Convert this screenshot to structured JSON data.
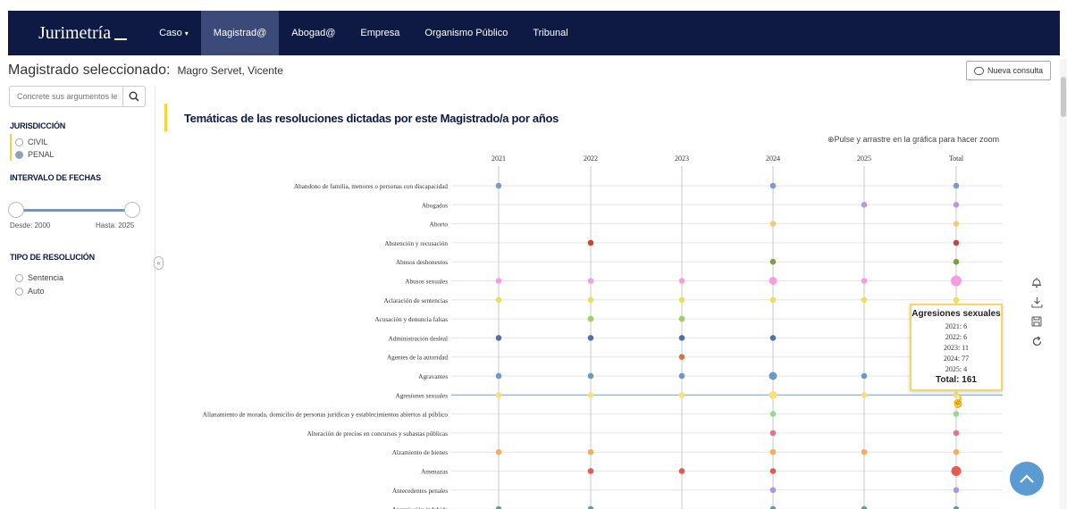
{
  "app": {
    "brand": "Jurimetría"
  },
  "nav": [
    {
      "label": "Caso",
      "dropdown": true,
      "active": false
    },
    {
      "label": "Magistrad@",
      "dropdown": false,
      "active": true
    },
    {
      "label": "Abogad@",
      "dropdown": false,
      "active": false
    },
    {
      "label": "Empresa",
      "dropdown": false,
      "active": false
    },
    {
      "label": "Organismo Público",
      "dropdown": false,
      "active": false
    },
    {
      "label": "Tribunal",
      "dropdown": false,
      "active": false
    }
  ],
  "header": {
    "selected_label": "Magistrado seleccionado:",
    "selected_value": "Magro Servet, Vicente",
    "new_query": "Nueva consulta"
  },
  "sidebar": {
    "search_placeholder": "Concrete sus argumentos le",
    "jurisdiccion_title": "JURISDICCIÓN",
    "jurisdicciones": [
      {
        "label": "CIVIL",
        "selected": false
      },
      {
        "label": "PENAL",
        "selected": true
      }
    ],
    "intervalo_title": "INTERVALO DE FECHAS",
    "desde": "Desde: 2000",
    "hasta": "Hasta: 2025",
    "tipo_title": "TIPO DE RESOLUCIÓN",
    "tipos": [
      {
        "label": "Sentencia",
        "selected": false
      },
      {
        "label": "Auto",
        "selected": false
      }
    ]
  },
  "chart": {
    "title": "Temáticas de las resoluciones dictadas por este Magistrado/a por años",
    "zoom_hint": "Pulse y arrastre en la gráfica para hacer zoom"
  },
  "chart_data": {
    "type": "scatter",
    "columns": [
      "2021",
      "2022",
      "2023",
      "2024",
      "2025",
      "Total"
    ],
    "rows": [
      {
        "label": "Abandono de familia, menores o personas con discapacidad",
        "color": "#7b9cc9",
        "present": [
          1,
          0,
          0,
          1,
          0,
          1
        ]
      },
      {
        "label": "Abogados",
        "color": "#b79ad8",
        "present": [
          0,
          0,
          0,
          0,
          1,
          1
        ]
      },
      {
        "label": "Aborto",
        "color": "#f7c97a",
        "present": [
          0,
          0,
          0,
          1,
          0,
          1
        ]
      },
      {
        "label": "Abstención y recusación",
        "color": "#c9433f",
        "present": [
          0,
          1,
          0,
          0,
          0,
          1
        ]
      },
      {
        "label": "Abusos deshonestos",
        "color": "#7a9e45",
        "present": [
          0,
          0,
          0,
          1,
          0,
          1
        ]
      },
      {
        "label": "Abusos sexuales",
        "color": "#f59de0",
        "present": [
          1,
          1,
          1,
          1,
          1,
          1
        ],
        "emphasis": [
          0,
          0,
          0,
          1,
          0,
          1
        ]
      },
      {
        "label": "Aclaración de sentencias",
        "color": "#eddd5e",
        "present": [
          1,
          1,
          1,
          1,
          1,
          1
        ]
      },
      {
        "label": "Acusación y denuncia falsas",
        "color": "#9ccf5b",
        "present": [
          0,
          1,
          1,
          0,
          0,
          1
        ]
      },
      {
        "label": "Administración desleal",
        "color": "#55709e",
        "present": [
          1,
          1,
          1,
          1,
          0,
          1
        ]
      },
      {
        "label": "Agentes de la autoridad",
        "color": "#d9733d",
        "present": [
          0,
          0,
          1,
          0,
          0,
          1
        ]
      },
      {
        "label": "Agravantes",
        "color": "#6b99c7",
        "present": [
          1,
          1,
          1,
          1,
          1,
          1
        ],
        "emphasis": [
          0,
          0,
          0,
          1,
          0,
          0
        ]
      },
      {
        "label": "Agresiones sexuales",
        "color": "#f7e07a",
        "present": [
          1,
          1,
          1,
          1,
          1,
          1
        ],
        "values": [
          6,
          6,
          11,
          77,
          4,
          161
        ],
        "highlight": true
      },
      {
        "label": "Allanamiento de morada, domicilio de personas jurídicas y establecimientos abiertos al público",
        "color": "#9ad88e",
        "present": [
          0,
          0,
          0,
          1,
          0,
          1
        ]
      },
      {
        "label": "Alteración de precios en concursos y subastas públicas",
        "color": "#e8728c",
        "present": [
          0,
          0,
          0,
          1,
          0,
          1
        ]
      },
      {
        "label": "Alzamiento de bienes",
        "color": "#f5ac5e",
        "present": [
          1,
          1,
          0,
          1,
          1,
          1
        ]
      },
      {
        "label": "Amenazas",
        "color": "#e6594f",
        "present": [
          0,
          1,
          1,
          1,
          0,
          1
        ],
        "emphasis": [
          0,
          0,
          0,
          0,
          0,
          1
        ]
      },
      {
        "label": "Antecedentes penales",
        "color": "#b392de",
        "present": [
          0,
          0,
          0,
          1,
          0,
          1
        ]
      },
      {
        "label": "Apropiación indebida",
        "color": "#4fa39a",
        "present": [
          1,
          1,
          0,
          1,
          1,
          1
        ]
      }
    ],
    "tooltip": {
      "title": "Agresiones sexuales",
      "lines": [
        "2021: 6",
        "2022: 6",
        "2023: 11",
        "2024: 77",
        "2025: 4"
      ],
      "total": "Total: 161"
    }
  },
  "colors": {
    "navy": "#0e1a44",
    "accent": "#f5d33f",
    "active_nav": "#3b4a78",
    "fab": "#5a9bd3"
  },
  "icons": [
    "search-icon",
    "chat-bubble-icon",
    "bell-icon",
    "download-icon",
    "save-icon",
    "refresh-icon",
    "chevron-up-icon",
    "zoom-icon",
    "collapse-left-icon",
    "hand-cursor-icon"
  ]
}
